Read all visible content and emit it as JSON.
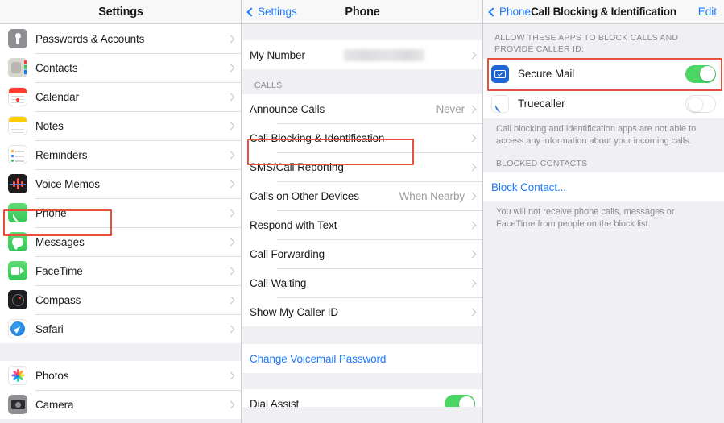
{
  "left_panel": {
    "title": "Settings",
    "groups": [
      {
        "items": [
          {
            "label": "Passwords & Accounts",
            "icon": "passwords-icon"
          },
          {
            "label": "Contacts",
            "icon": "contacts-icon"
          },
          {
            "label": "Calendar",
            "icon": "calendar-icon"
          },
          {
            "label": "Notes",
            "icon": "notes-icon"
          },
          {
            "label": "Reminders",
            "icon": "reminders-icon"
          },
          {
            "label": "Voice Memos",
            "icon": "voice-memos-icon"
          },
          {
            "label": "Phone",
            "icon": "phone-icon",
            "highlighted": true
          },
          {
            "label": "Messages",
            "icon": "messages-icon"
          },
          {
            "label": "FaceTime",
            "icon": "facetime-icon"
          },
          {
            "label": "Compass",
            "icon": "compass-icon"
          },
          {
            "label": "Safari",
            "icon": "safari-icon"
          }
        ]
      },
      {
        "items": [
          {
            "label": "Photos",
            "icon": "photos-icon"
          },
          {
            "label": "Camera",
            "icon": "camera-icon"
          }
        ]
      }
    ]
  },
  "mid_panel": {
    "back_label": "Settings",
    "title": "Phone",
    "my_number_label": "My Number",
    "my_number_value": "",
    "calls_header": "CALLS",
    "call_rows": [
      {
        "label": "Announce Calls",
        "value": "Never"
      },
      {
        "label": "Call Blocking & Identification",
        "value": "",
        "highlighted": true
      },
      {
        "label": "SMS/Call Reporting",
        "value": ""
      },
      {
        "label": "Calls on Other Devices",
        "value": "When Nearby"
      },
      {
        "label": "Respond with Text",
        "value": ""
      },
      {
        "label": "Call Forwarding",
        "value": ""
      },
      {
        "label": "Call Waiting",
        "value": ""
      },
      {
        "label": "Show My Caller ID",
        "value": ""
      }
    ],
    "voicemail_link": "Change Voicemail Password",
    "dial_assist_label": "Dial Assist"
  },
  "right_panel": {
    "back_label": "Phone",
    "title": "Call Blocking & Identification",
    "edit_label": "Edit",
    "apps_header": "ALLOW THESE APPS TO BLOCK CALLS AND PROVIDE CALLER ID:",
    "apps": [
      {
        "label": "Secure Mail",
        "icon": "secure-mail-icon",
        "toggle": "on",
        "highlighted": true
      },
      {
        "label": "Truecaller",
        "icon": "truecaller-icon",
        "toggle": "off",
        "highlighted": false
      }
    ],
    "apps_footer": "Call blocking and identification apps are not able to access any information about your incoming calls.",
    "blocked_header": "BLOCKED CONTACTS",
    "block_contact_link": "Block Contact...",
    "blocked_footer": "You will not receive phone calls, messages or FaceTime from people on the block list."
  },
  "colors": {
    "accent_blue": "#1a7aff",
    "highlight_red": "#e8503a",
    "toggle_green": "#4cd764",
    "group_bg": "#efeff4"
  }
}
